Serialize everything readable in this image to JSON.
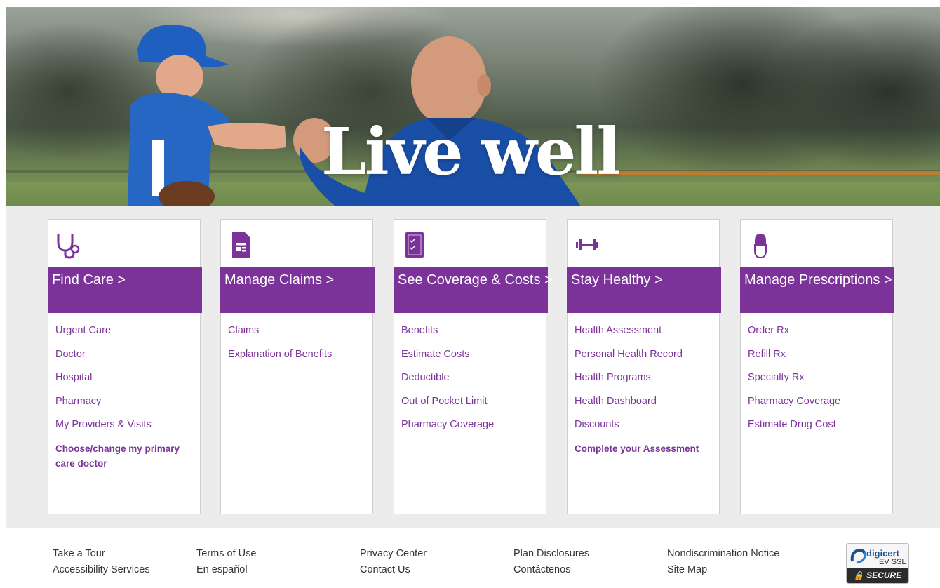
{
  "hero": {
    "title": "Live well"
  },
  "cards": [
    {
      "heading": "Find Care >",
      "icon": "stethoscope-icon",
      "links": [
        "Urgent Care",
        "Doctor",
        "Hospital",
        "Pharmacy",
        "My Providers & Visits"
      ],
      "strong_link": "Choose/change my primary care doctor"
    },
    {
      "heading": "Manage Claims >",
      "icon": "document-icon",
      "links": [
        "Claims",
        "Explanation of Benefits"
      ]
    },
    {
      "heading": "See Coverage & Costs >",
      "icon": "clipboard-check-icon",
      "links": [
        "Benefits",
        "Estimate Costs",
        "Deductible",
        "Out of Pocket Limit",
        "Pharmacy Coverage"
      ]
    },
    {
      "heading": "Stay Healthy >",
      "icon": "dumbbell-icon",
      "links": [
        "Health Assessment",
        "Personal Health Record",
        "Health Programs",
        "Health Dashboard",
        "Discounts"
      ],
      "strong_link": "Complete your Assessment"
    },
    {
      "heading": "Manage Prescriptions >",
      "icon": "pill-capsule-icon",
      "links": [
        "Order Rx",
        "Refill Rx",
        "Specialty Rx",
        "Pharmacy Coverage",
        "Estimate Drug Cost"
      ]
    }
  ],
  "footer": {
    "columns": [
      [
        "Take a Tour",
        "Accessibility Services"
      ],
      [
        "Terms of Use",
        "En español"
      ],
      [
        "Privacy Center",
        "Contact Us"
      ],
      [
        "Plan Disclosures",
        "Contáctenos"
      ],
      [
        "Nondiscrimination Notice",
        "Site Map"
      ]
    ],
    "badge": {
      "brand": "digicert",
      "type": "EV SSL",
      "secure": "SECURE"
    }
  },
  "colors": {
    "brand_purple": "#7b3299",
    "band_gray": "#ececec"
  }
}
